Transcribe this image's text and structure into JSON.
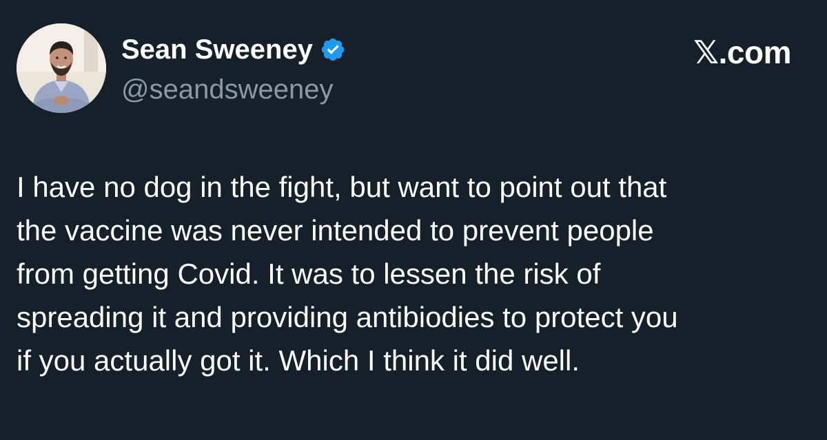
{
  "tweet": {
    "author_name": "Sean Sweeney",
    "handle": "@seandsweeney",
    "site": "𝕏.com",
    "text": "I have no dog in the fight, but want to point out that\nthe vaccine was never intended to prevent people\nfrom getting Covid.  It was to lessen the risk of\nspreading it and providing antibiodies to protect you\nif you actually got it.  Which I think it did well."
  },
  "icons": {
    "verified": "verified-badge-icon",
    "avatar": "profile-photo"
  },
  "colors": {
    "background": "#15202b",
    "text": "#ffffff",
    "handle": "#8b98a5",
    "verified": "#1d9bf0"
  }
}
